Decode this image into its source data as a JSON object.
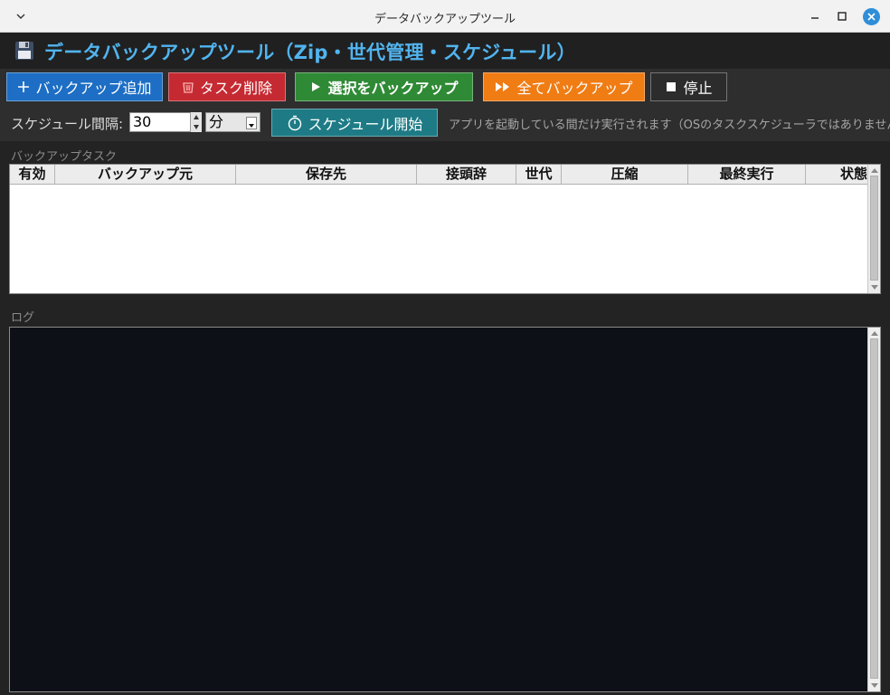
{
  "window": {
    "title": "データバックアップツール"
  },
  "header": {
    "title": "データバックアップツール（Zip・世代管理・スケジュール）",
    "icon": "floppy-disk-icon",
    "title_color": "#51b4ef"
  },
  "toolbar": {
    "add_label": "バックアップ追加",
    "delete_label": "タスク削除",
    "run_selected_label": "選択をバックアップ",
    "run_all_label": "全てバックアップ",
    "stop_label": "停止",
    "colors": {
      "add": "#1d6ec4",
      "delete": "#c52a32",
      "run_selected": "#2f8a35",
      "run_all": "#f07c14",
      "stop": "#2c2c2c",
      "schedule": "#1e7b85"
    }
  },
  "schedule": {
    "interval_label": "スケジュール間隔:",
    "interval_value": "30",
    "unit_value": "分",
    "start_label": "スケジュール開始",
    "note": "アプリを起動している間だけ実行されます（OSのタスクスケジューラではありません）"
  },
  "tasks": {
    "section_label": "バックアップタスク",
    "columns": [
      "有効",
      "バックアップ元",
      "保存先",
      "接頭辞",
      "世代",
      "圧縮",
      "最終実行",
      "状態"
    ],
    "rows": []
  },
  "log": {
    "section_label": "ログ",
    "lines": []
  }
}
